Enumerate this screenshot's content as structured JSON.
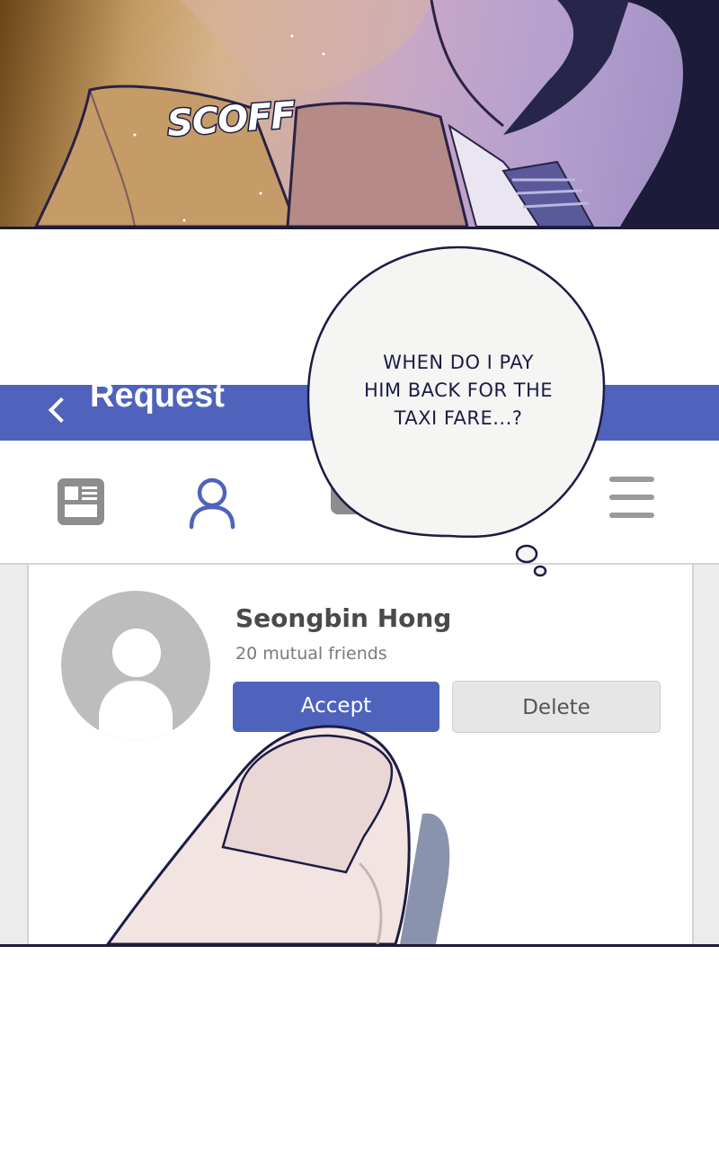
{
  "top_panel": {
    "sound_effect": "SCOFF"
  },
  "thought_bubble": {
    "lines": [
      "WHEN DO I PAY",
      "HIM BACK FOR THE",
      "TAXI FARE...?"
    ]
  },
  "app": {
    "header": {
      "back_icon": "chevron-left-icon",
      "title": "Request"
    },
    "nav": {
      "items": [
        {
          "icon": "news-feed-icon",
          "active": false
        },
        {
          "icon": "friends-icon",
          "active": true
        },
        {
          "icon": "chat-icon",
          "active": false
        },
        {
          "icon": "menu-icon",
          "active": false
        }
      ]
    },
    "friend_request": {
      "name": "Seongbin Hong",
      "mutual_friends": "20 mutual friends",
      "accept_label": "Accept",
      "delete_label": "Delete"
    },
    "colors": {
      "accent": "#4f63bd",
      "background": "#ececec",
      "muted_button": "#e6e6e6"
    }
  }
}
